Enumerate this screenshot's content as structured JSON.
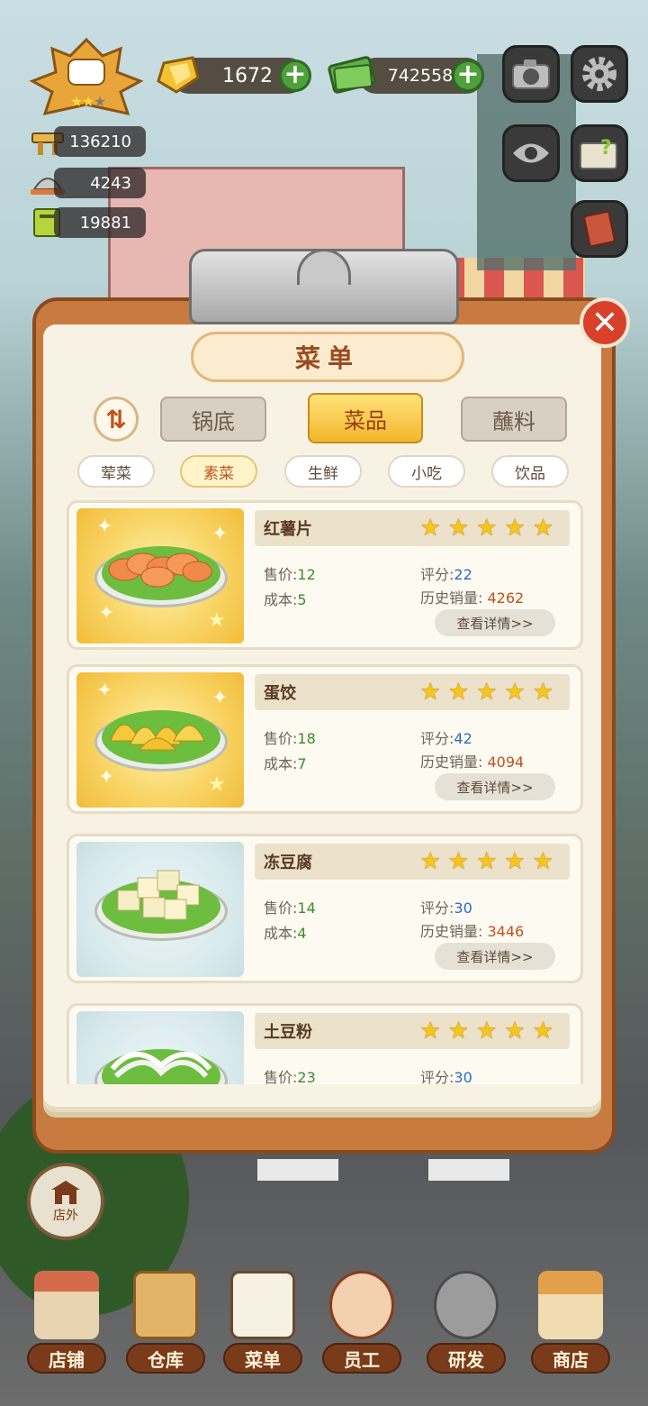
{
  "hud": {
    "gems": "1672",
    "cash": "7425584",
    "stats": [
      "136210",
      "4243",
      "19881"
    ]
  },
  "menu": {
    "title": "菜单",
    "tabs": [
      "锅底",
      "菜品",
      "蘸料"
    ],
    "active_tab": 1,
    "subtabs": [
      "荤菜",
      "素菜",
      "生鲜",
      "小吃",
      "饮品"
    ],
    "active_subtab": 1,
    "labels": {
      "price": "售价",
      "cost": "成本",
      "score": "评分",
      "sales": "历史销量",
      "detail": "查看详情>>"
    },
    "dishes": [
      {
        "name": "红薯片",
        "price": "12",
        "cost": "5",
        "score": "22",
        "sales": "4262",
        "stars": 5
      },
      {
        "name": "蛋饺",
        "price": "18",
        "cost": "7",
        "score": "42",
        "sales": "4094",
        "stars": 5
      },
      {
        "name": "冻豆腐",
        "price": "14",
        "cost": "4",
        "score": "30",
        "sales": "3446",
        "stars": 5
      },
      {
        "name": "土豆粉",
        "price": "23",
        "score": "30",
        "stars": 5
      }
    ]
  },
  "outside_label": "店外",
  "nav": [
    "店铺",
    "仓库",
    "菜单",
    "员工",
    "研发",
    "商店"
  ],
  "colors": {
    "accent": "#f2b62c",
    "board": "#c97a3e",
    "close": "#d8402a"
  }
}
